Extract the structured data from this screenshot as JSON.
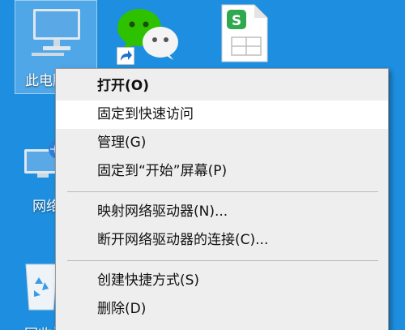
{
  "desktop": {
    "icons": [
      {
        "label": "此电脑",
        "icon": "computer-icon"
      },
      {
        "label": "",
        "icon": "wechat-icon"
      },
      {
        "label": "",
        "icon": "wps-spreadsheet-icon"
      },
      {
        "label": "网络",
        "icon": "network-icon"
      },
      {
        "label": "回收站",
        "icon": "recycle-bin-icon"
      }
    ],
    "wps_badge": "S",
    "colors": {
      "background": "#1e8fe0",
      "wechat": "#2dc100",
      "wps": "#2fa84f"
    }
  },
  "context_menu": {
    "items": [
      {
        "label": "打开(O)"
      },
      {
        "label": "固定到快速访问"
      },
      {
        "label": "管理(G)"
      },
      {
        "label": "固定到“开始”屏幕(P)"
      },
      {
        "label": "映射网络驱动器(N)..."
      },
      {
        "label": "断开网络驱动器的连接(C)..."
      },
      {
        "label": "创建快捷方式(S)"
      },
      {
        "label": "删除(D)"
      }
    ]
  }
}
